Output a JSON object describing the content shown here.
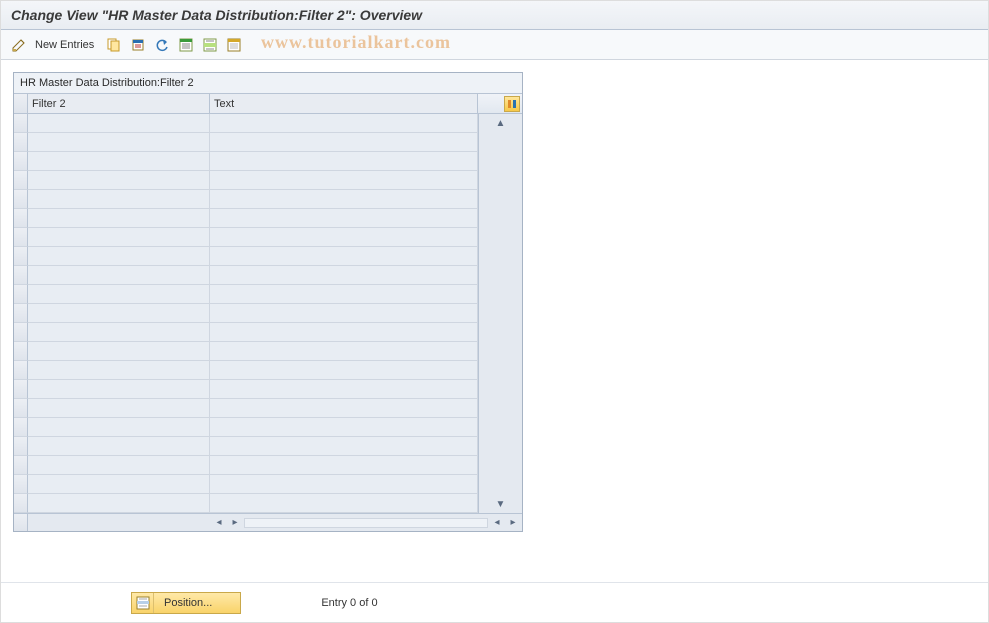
{
  "title": "Change View \"HR Master Data Distribution:Filter 2\": Overview",
  "toolbar": {
    "new_entries_label": "New Entries"
  },
  "watermark": "www.tutorialkart.com",
  "panel": {
    "title": "HR Master Data Distribution:Filter 2",
    "columns": {
      "filter2": "Filter 2",
      "text": "Text"
    },
    "rows": [
      {
        "filter2": "",
        "text": ""
      },
      {
        "filter2": "",
        "text": ""
      },
      {
        "filter2": "",
        "text": ""
      },
      {
        "filter2": "",
        "text": ""
      },
      {
        "filter2": "",
        "text": ""
      },
      {
        "filter2": "",
        "text": ""
      },
      {
        "filter2": "",
        "text": ""
      },
      {
        "filter2": "",
        "text": ""
      },
      {
        "filter2": "",
        "text": ""
      },
      {
        "filter2": "",
        "text": ""
      },
      {
        "filter2": "",
        "text": ""
      },
      {
        "filter2": "",
        "text": ""
      },
      {
        "filter2": "",
        "text": ""
      },
      {
        "filter2": "",
        "text": ""
      },
      {
        "filter2": "",
        "text": ""
      },
      {
        "filter2": "",
        "text": ""
      },
      {
        "filter2": "",
        "text": ""
      },
      {
        "filter2": "",
        "text": ""
      },
      {
        "filter2": "",
        "text": ""
      },
      {
        "filter2": "",
        "text": ""
      },
      {
        "filter2": "",
        "text": ""
      }
    ]
  },
  "footer": {
    "position_label": "Position...",
    "entry_text": "Entry 0 of 0"
  }
}
